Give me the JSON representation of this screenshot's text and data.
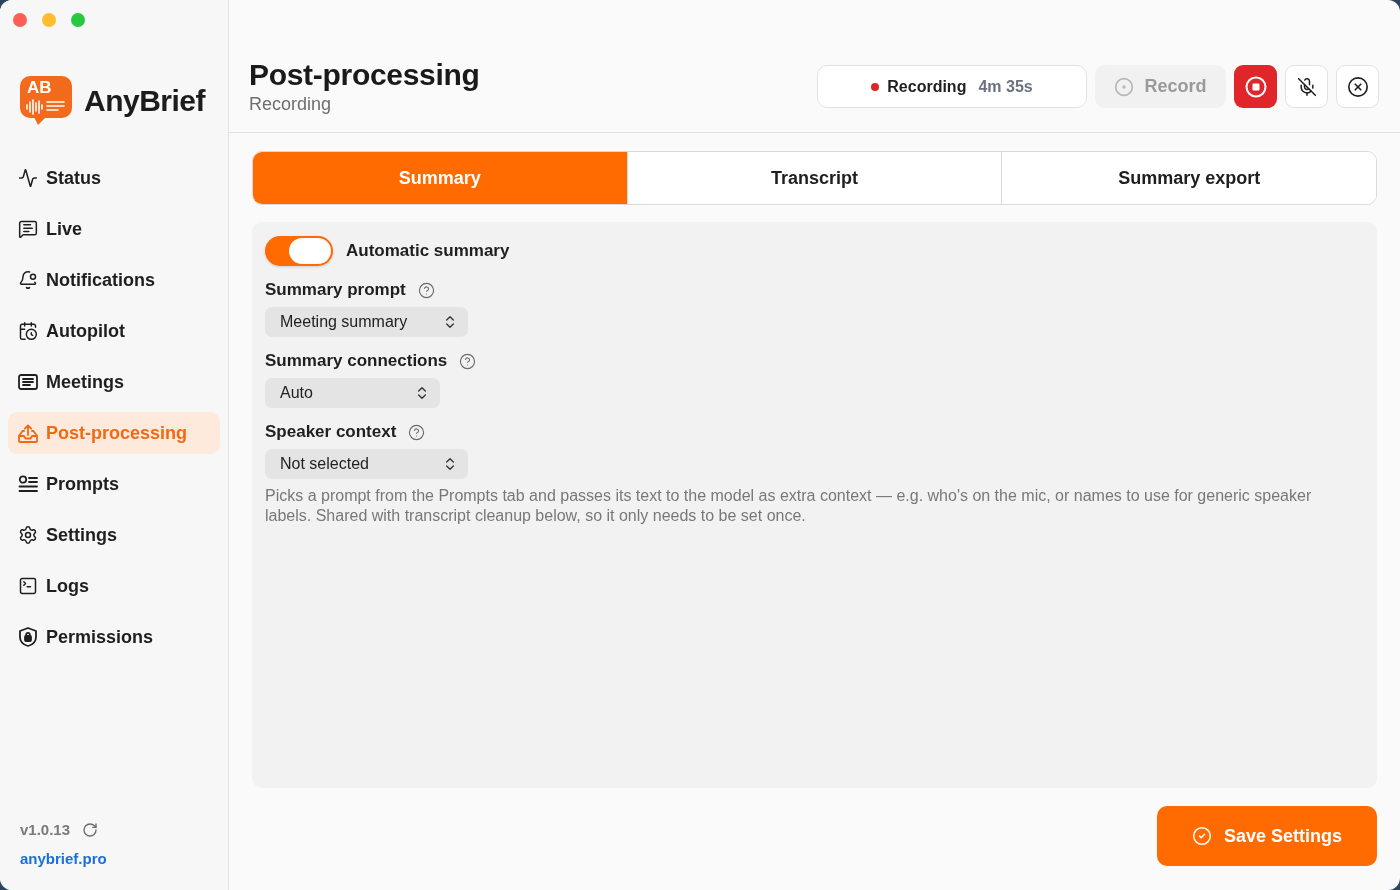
{
  "sidebar": {
    "logo_text": "AB",
    "brand": "AnyBrief",
    "items": [
      {
        "label": "Status",
        "selected": false
      },
      {
        "label": "Live",
        "selected": false
      },
      {
        "label": "Notifications",
        "selected": false
      },
      {
        "label": "Autopilot",
        "selected": false
      },
      {
        "label": "Meetings",
        "selected": false
      },
      {
        "label": "Post-processing",
        "selected": true
      },
      {
        "label": "Prompts",
        "selected": false
      },
      {
        "label": "Settings",
        "selected": false
      },
      {
        "label": "Logs",
        "selected": false
      },
      {
        "label": "Permissions",
        "selected": false
      }
    ],
    "version": "v1.0.13",
    "link": "anybrief.pro"
  },
  "header": {
    "title": "Post-processing",
    "subtitle": "Recording",
    "recording": {
      "label": "Recording",
      "elapsed": "4m 35s"
    },
    "record_button": {
      "label": "Record",
      "disabled": true
    }
  },
  "tabs": [
    {
      "label": "Summary",
      "selected": true
    },
    {
      "label": "Transcript",
      "selected": false
    },
    {
      "label": "Summary export",
      "selected": false
    }
  ],
  "panel": {
    "toggle": {
      "label": "Automatic summary",
      "on": true
    },
    "fields": [
      {
        "label": "Summary prompt",
        "value": "Meeting summary"
      },
      {
        "label": "Summary connections",
        "value": "Auto"
      },
      {
        "label": "Speaker context",
        "value": "Not selected"
      }
    ],
    "help_text": "Picks a prompt from the Prompts tab and passes its text to the model as extra context — e.g. who's on the mic, or names to use for generic speaker labels. Shared with transcript cleanup below, so it only needs to be set once."
  },
  "save_button": {
    "label": "Save Settings"
  }
}
